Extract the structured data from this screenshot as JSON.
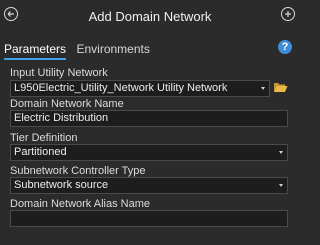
{
  "header": {
    "title": "Add Domain Network"
  },
  "tabs": [
    {
      "label": "Parameters"
    },
    {
      "label": "Environments"
    }
  ],
  "help": {
    "label": "?"
  },
  "form": {
    "input_utility_network": {
      "label": "Input Utility Network",
      "value": "L950Electric_Utility_Network Utility Network"
    },
    "domain_network_name": {
      "label": "Domain Network Name",
      "value": "Electric Distribution"
    },
    "tier_definition": {
      "label": "Tier Definition",
      "value": "Partitioned"
    },
    "subnetwork_controller_type": {
      "label": "Subnetwork Controller Type",
      "value": "Subnetwork source"
    },
    "domain_network_alias_name": {
      "label": "Domain Network Alias Name",
      "value": ""
    }
  },
  "colors": {
    "accent": "#3fa2e8",
    "folder": "#e8b84a",
    "background": "#2b2b2b"
  }
}
